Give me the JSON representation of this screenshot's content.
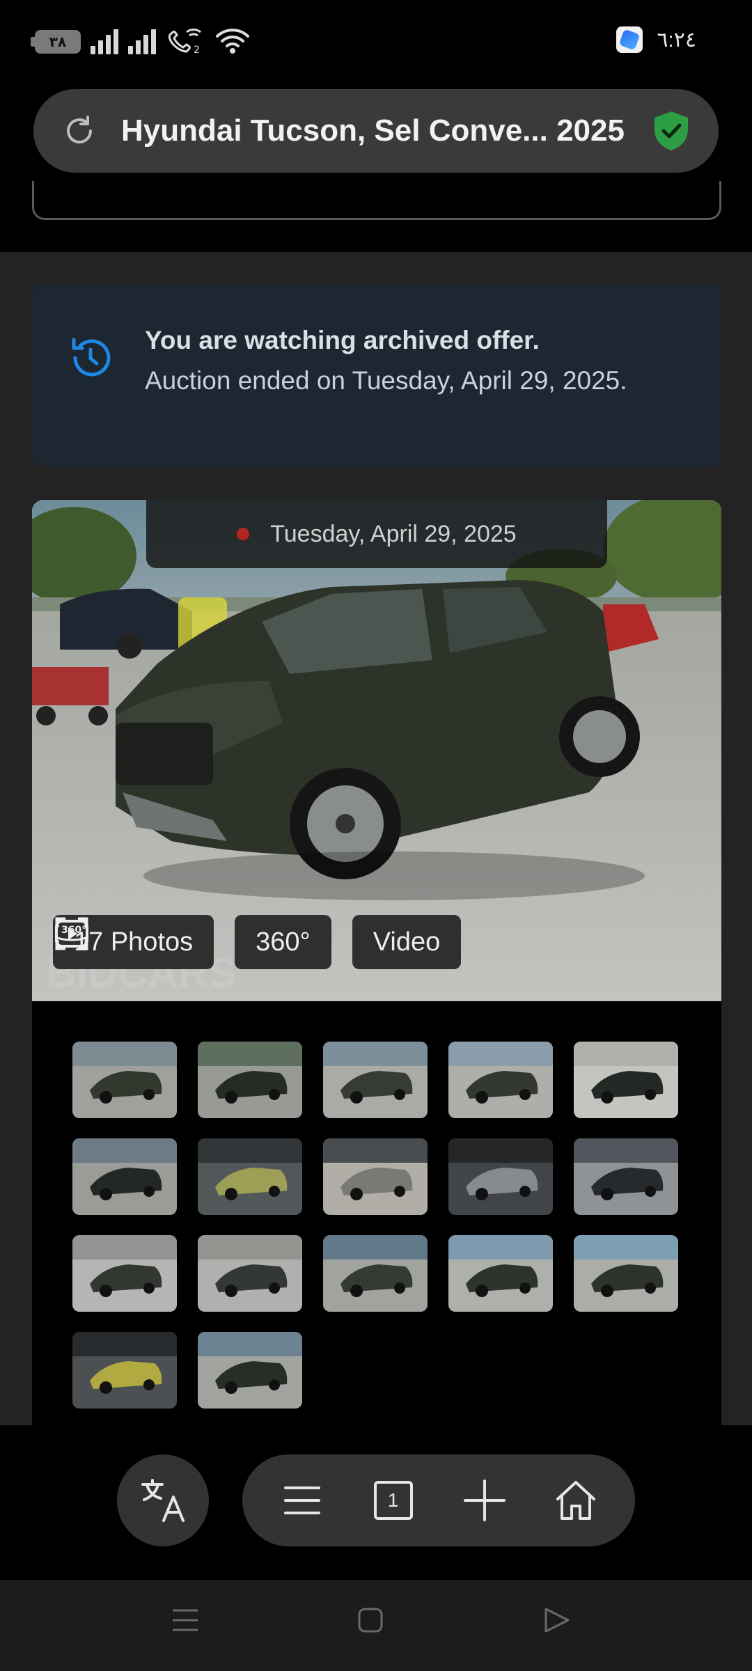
{
  "status_bar": {
    "battery": "٣٨",
    "time": "٦:٢٤",
    "icons": [
      "battery-icon",
      "signal-icon",
      "signal-icon",
      "wifi-calling-icon",
      "wifi-icon",
      "app-notification-icon"
    ]
  },
  "browser": {
    "url_title": "Hyundai Tucson, Sel Conve... 2025",
    "reload_icon": "reload-icon",
    "security_icon": "verified-shield-icon"
  },
  "archive_notice": {
    "title": "You are watching archived offer.",
    "message": "Auction ended on Tuesday, April 29, 2025."
  },
  "gallery": {
    "date": "Tuesday, April 29, 2025",
    "photos_label": "17 Photos",
    "view360_label": "360°",
    "video_label": "Video",
    "thumbnail_count": 17
  },
  "bottom_bar": {
    "tab_count": "1",
    "icons": [
      "translate-icon",
      "menu-icon",
      "tabs-icon",
      "new-tab-icon",
      "home-icon"
    ]
  },
  "colors": {
    "background": "#232323",
    "notice_bg": "#1d2731",
    "accent_blue": "#1e88e5",
    "shield_green": "#2e9e44",
    "live_dot": "#b3261e"
  }
}
